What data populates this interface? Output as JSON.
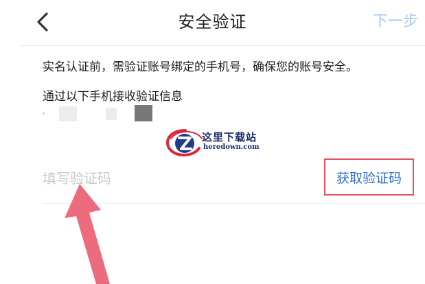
{
  "header": {
    "title": "安全验证",
    "next_label": "下一步"
  },
  "main": {
    "notice": "实名认证前，需验证账号绑定的手机号，确保您的账号安全。",
    "receive_label": "通过以下手机接收验证信息",
    "code_input": {
      "placeholder": "填写验证码",
      "value": ""
    },
    "get_code_label": "获取验证码"
  },
  "watermark": {
    "cn": "这里下载站",
    "en": "heredown.com"
  },
  "colors": {
    "next_disabled": "#a9c6ee",
    "link_blue": "#2f6fcf",
    "highlight_border": "#e0505a",
    "arrow": "#ec6b7c"
  },
  "icons": {
    "back": "chevron-left-icon",
    "logo": "heredown-logo-icon",
    "annotation_arrow": "arrow-up-icon"
  }
}
